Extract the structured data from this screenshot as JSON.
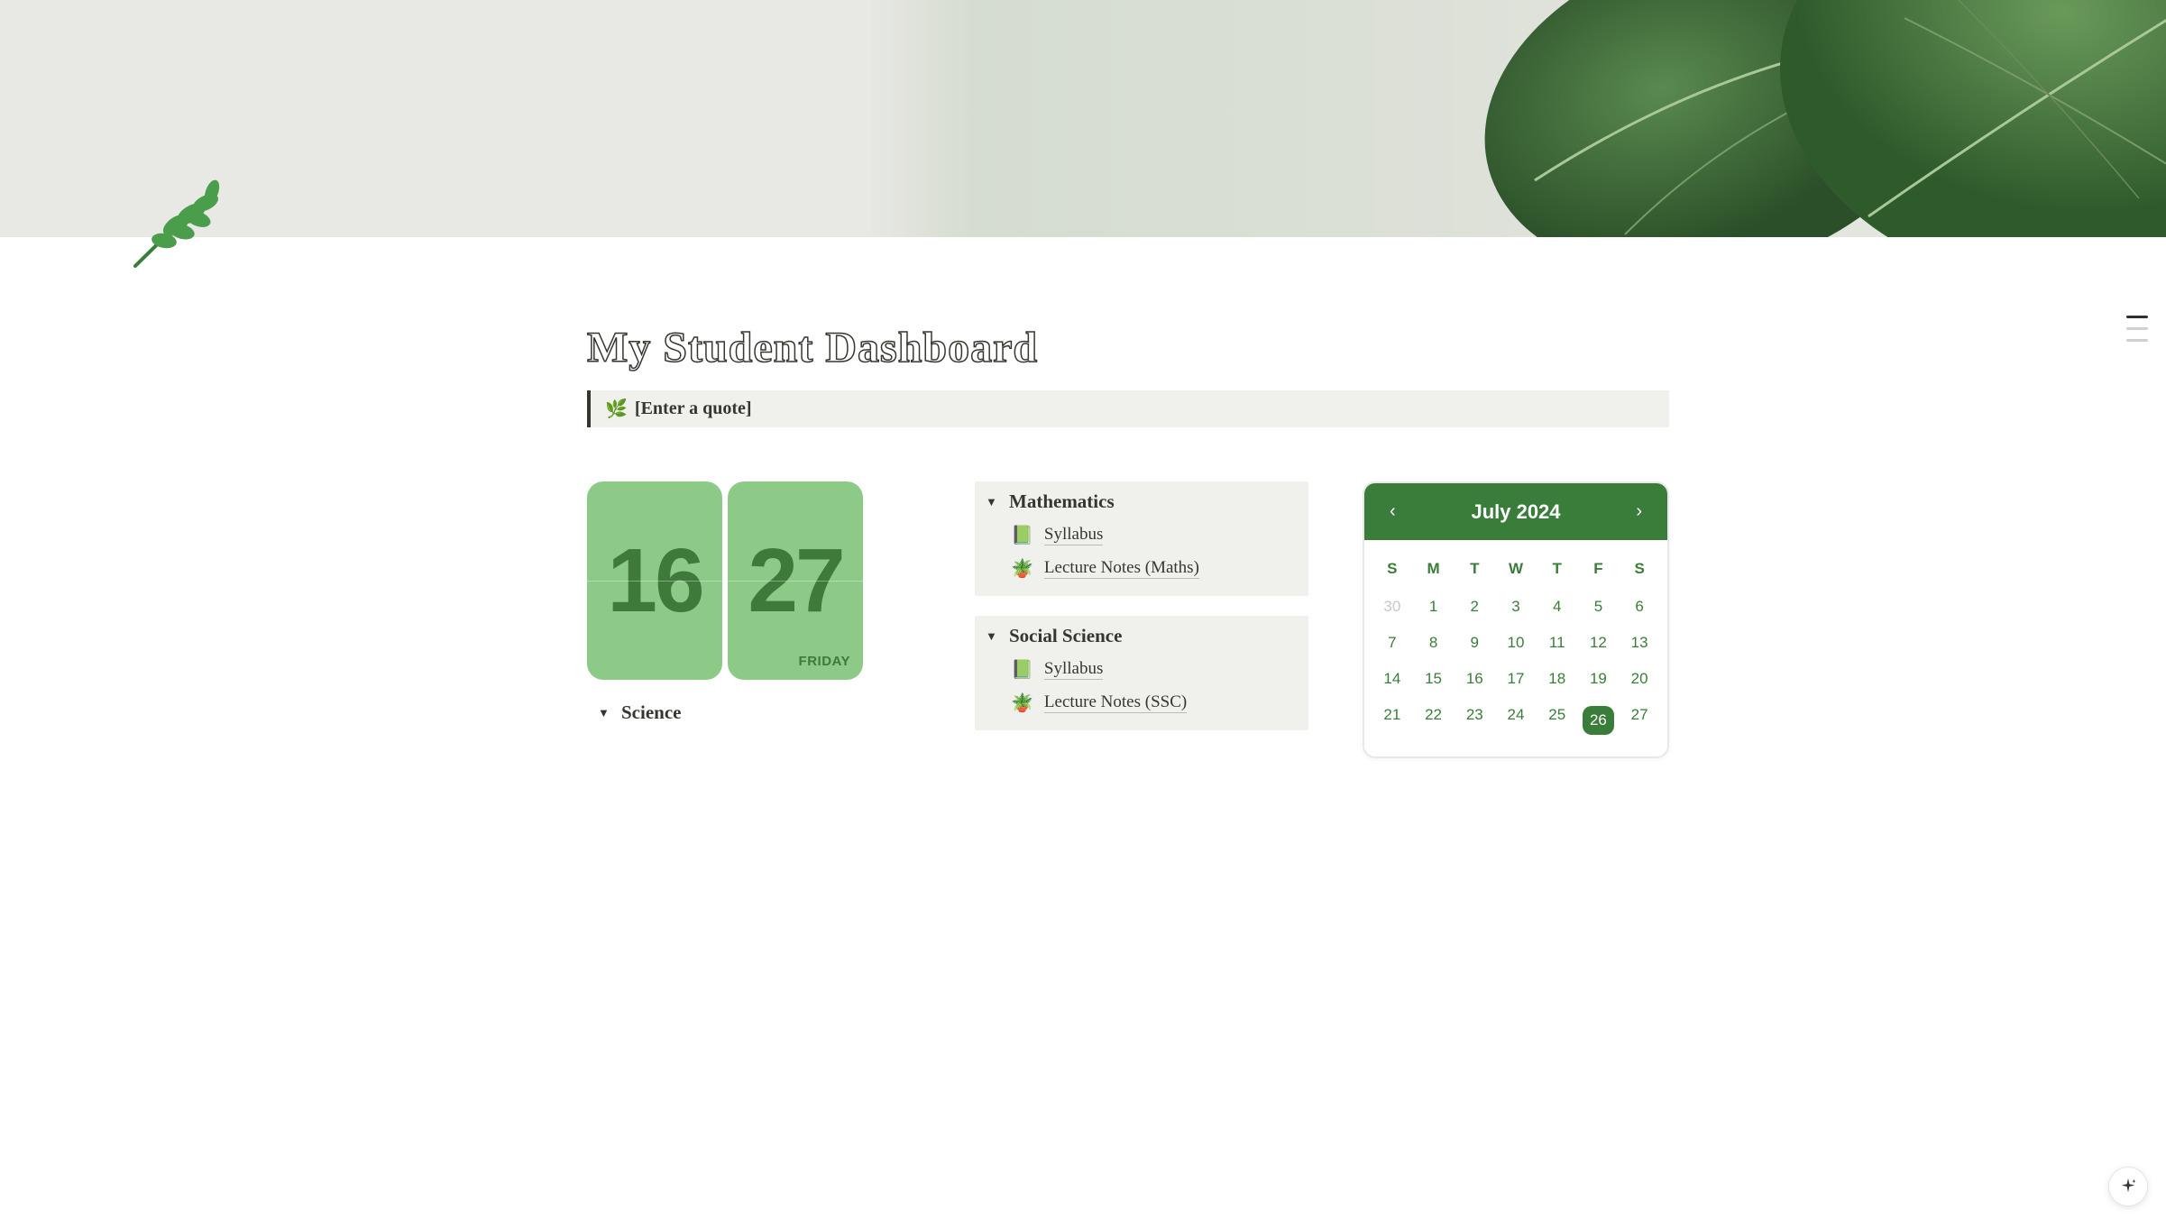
{
  "page": {
    "title": "My Student Dashboard",
    "quote_placeholder": "[Enter a quote]",
    "icon_name": "herb-icon"
  },
  "date_widget": {
    "hour": "16",
    "minute": "27",
    "day_label": "FRIDAY"
  },
  "toggles": {
    "science": {
      "title": "Science"
    },
    "mathematics": {
      "title": "Mathematics",
      "items": [
        {
          "icon": "📗",
          "label": "Syllabus"
        },
        {
          "icon": "🪴",
          "label": "Lecture Notes (Maths)"
        }
      ]
    },
    "social_science": {
      "title": "Social Science",
      "items": [
        {
          "icon": "📗",
          "label": "Syllabus"
        },
        {
          "icon": "🪴",
          "label": "Lecture Notes (SSC)"
        }
      ]
    }
  },
  "calendar": {
    "title": "July 2024",
    "dow": [
      "S",
      "M",
      "T",
      "W",
      "T",
      "F",
      "S"
    ],
    "prev_days": [
      30
    ],
    "days": [
      1,
      2,
      3,
      4,
      5,
      6,
      7,
      8,
      9,
      10,
      11,
      12,
      13,
      14,
      15,
      16,
      17,
      18,
      19,
      20,
      21,
      22,
      23,
      24,
      25,
      26,
      27
    ],
    "today": 26
  }
}
